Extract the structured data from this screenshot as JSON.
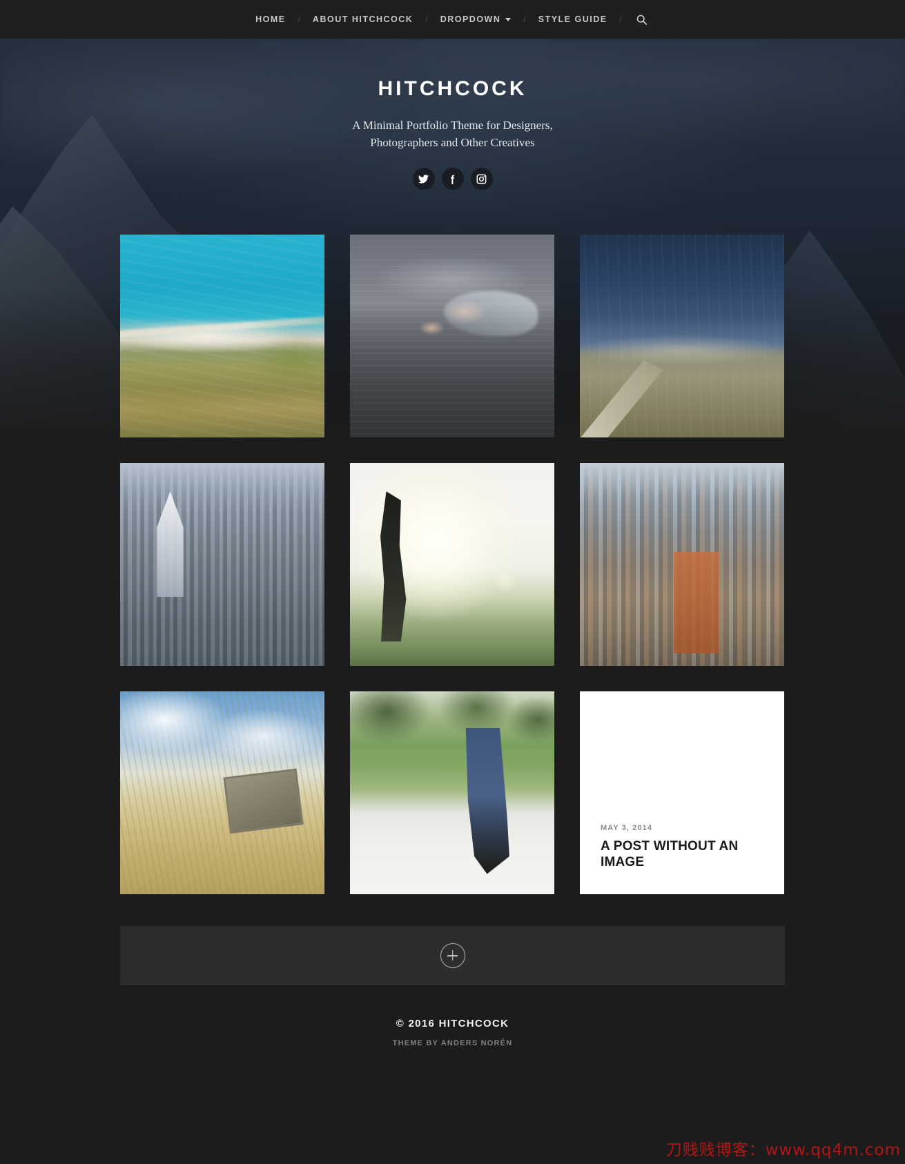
{
  "nav": {
    "items": [
      {
        "label": "HOME",
        "has_caret": false
      },
      {
        "label": "ABOUT HITCHCOCK",
        "has_caret": false
      },
      {
        "label": "DROPDOWN",
        "has_caret": true
      },
      {
        "label": "STYLE GUIDE",
        "has_caret": false
      }
    ],
    "separator": "/",
    "search_icon": "search-icon"
  },
  "hero": {
    "title": "HITCHCOCK",
    "tagline_line1": "A Minimal Portfolio Theme for Designers,",
    "tagline_line2": "Photographers and Other Creatives",
    "social": [
      {
        "name": "twitter-icon"
      },
      {
        "name": "facebook-icon"
      },
      {
        "name": "instagram-icon"
      }
    ]
  },
  "grid": {
    "tiles": [
      {
        "kind": "image",
        "photo_class": "ph-coast",
        "alt": "Aerial view of turquoise coastline"
      },
      {
        "kind": "image",
        "photo_class": "ph-swim",
        "alt": "Swimmer doing front crawl in a lake"
      },
      {
        "kind": "image",
        "photo_class": "ph-road",
        "alt": "Country dirt road at dusk"
      },
      {
        "kind": "image",
        "photo_class": "ph-sf",
        "alt": "San Francisco skyline"
      },
      {
        "kind": "image",
        "photo_class": "ph-sun",
        "alt": "Backlit person in sunlight"
      },
      {
        "kind": "image",
        "photo_class": "ph-nyc",
        "alt": "New York City skyline"
      },
      {
        "kind": "image",
        "photo_class": "ph-tv",
        "alt": "Old television in dune grass"
      },
      {
        "kind": "image",
        "photo_class": "ph-walk",
        "alt": "Legs of a person walking on a path"
      },
      {
        "kind": "text",
        "date": "MAY 3, 2014",
        "title": "A POST WITHOUT AN IMAGE"
      }
    ]
  },
  "load_more": {
    "icon": "plus-icon"
  },
  "footer": {
    "copyright": "© 2016 HITCHCOCK",
    "credit": "THEME BY ANDERS NORÉN"
  },
  "watermark": {
    "text": "刀贱贱博客：www.qq4m.com",
    "color": "#b31616"
  },
  "colors": {
    "page_bg": "#1c1c1c",
    "nav_bg": "#1f1f1f",
    "loadmore_bg": "#2d2d2d",
    "card_bg": "#ffffff",
    "nav_text": "#c9c9c9"
  }
}
